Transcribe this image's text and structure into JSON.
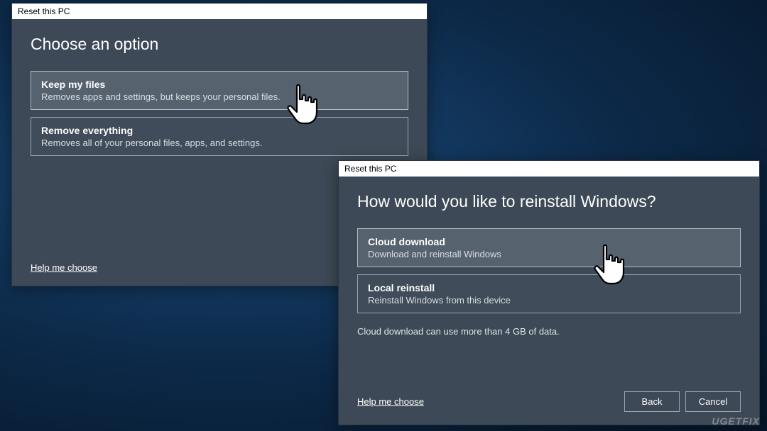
{
  "dialog1": {
    "title": "Reset this PC",
    "heading": "Choose an option",
    "options": [
      {
        "title": "Keep my files",
        "desc": "Removes apps and settings, but keeps your personal files."
      },
      {
        "title": "Remove everything",
        "desc": "Removes all of your personal files, apps, and settings."
      }
    ],
    "help_link": "Help me choose"
  },
  "dialog2": {
    "title": "Reset this PC",
    "heading": "How would you like to reinstall Windows?",
    "options": [
      {
        "title": "Cloud download",
        "desc": "Download and reinstall Windows"
      },
      {
        "title": "Local reinstall",
        "desc": "Reinstall Windows from this device"
      }
    ],
    "note": "Cloud download can use more than 4 GB of data.",
    "help_link": "Help me choose",
    "back_label": "Back",
    "cancel_label": "Cancel"
  },
  "watermark": "UGETFIX"
}
